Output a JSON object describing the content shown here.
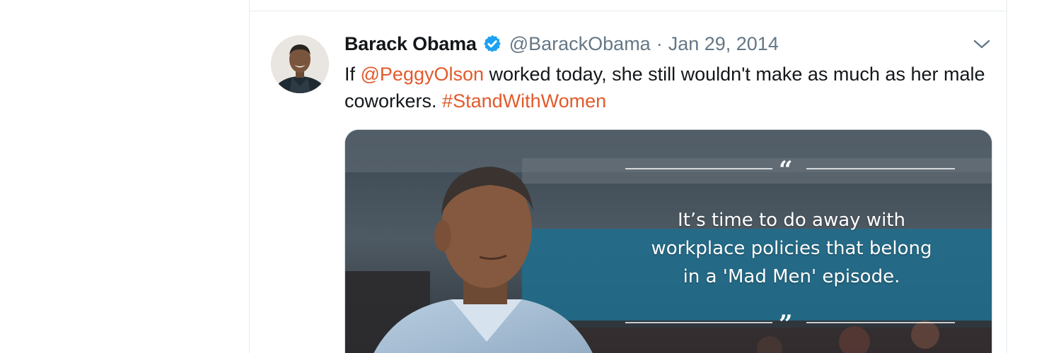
{
  "tweet": {
    "display_name": "Barack Obama",
    "screen_name": "@BarackObama",
    "separator": "·",
    "timestamp": "Jan 29, 2014",
    "text_before": "If ",
    "mention": "@PeggyOlson",
    "text_middle": " worked today, she still wouldn't make as much as her male coworkers. ",
    "hashtag": "#StandWithWomen",
    "verified": true,
    "link_color": "#e25a2b",
    "verified_color": "#1da1f2"
  },
  "media": {
    "open_quote_mark": "“",
    "close_quote_mark": "”",
    "quote_lines": [
      "It’s time to do away with",
      "workplace policies that belong",
      "in a 'Mad Men' episode."
    ]
  },
  "icons": {
    "verified": "verified-badge-icon",
    "caret": "chevron-down-icon"
  }
}
